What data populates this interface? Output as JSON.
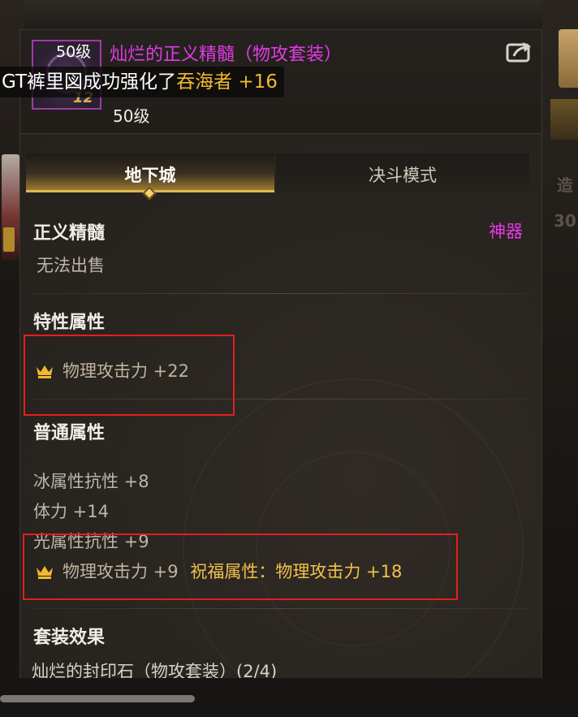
{
  "item": {
    "icon_level": "50级",
    "icon_enhance": "12",
    "title": "灿烂的正义精髓（物攻套装）",
    "level": "50级"
  },
  "broadcast": {
    "prefix": "GT裤里図成功强化了",
    "highlight": "吞海者 +16"
  },
  "tabs": [
    {
      "label": "地下城",
      "active": true
    },
    {
      "label": "决斗模式",
      "active": false
    }
  ],
  "details": {
    "name": "正义精髓",
    "rarity": "神器",
    "trade_status": "无法出售"
  },
  "special_attributes": {
    "heading": "特性属性",
    "items": [
      "物理攻击力 +22"
    ]
  },
  "normal_attributes": {
    "heading": "普通属性",
    "items": [
      "冰属性抗性 +8",
      "体力 +14",
      "光属性抗性 +9"
    ],
    "highlight_item": "物理攻击力 +9",
    "blessing": "祝福属性：物理攻击力 +18"
  },
  "set_effect": {
    "heading": "套装效果",
    "item": "灿烂的封印石（物攻套装）(2/4)"
  },
  "background": {
    "right_text_1": "造",
    "right_text_2": "30"
  },
  "colors": {
    "rarity_epic": "#e23ae6",
    "highlight_gold": "#f2b830",
    "annotation_red": "#e41e1e"
  }
}
